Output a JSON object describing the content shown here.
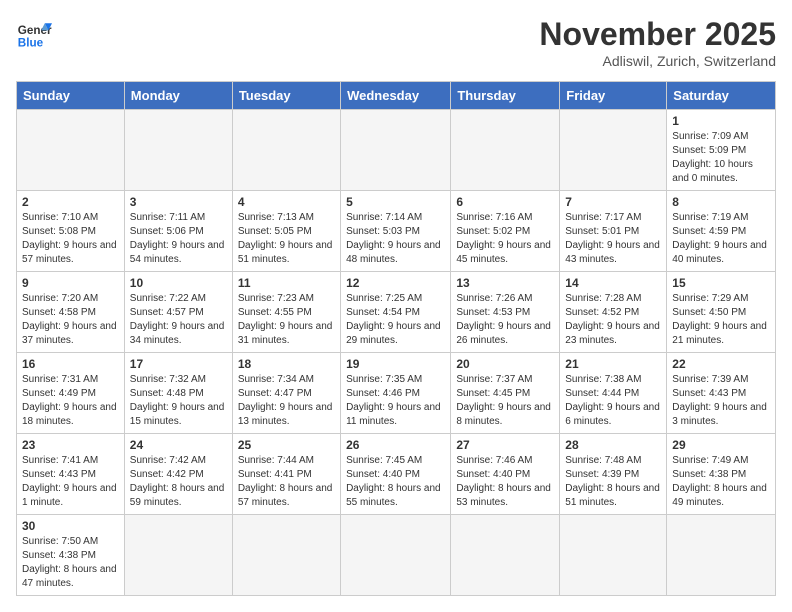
{
  "header": {
    "logo_general": "General",
    "logo_blue": "Blue",
    "month_title": "November 2025",
    "location": "Adliswil, Zurich, Switzerland"
  },
  "days_of_week": [
    "Sunday",
    "Monday",
    "Tuesday",
    "Wednesday",
    "Thursday",
    "Friday",
    "Saturday"
  ],
  "weeks": [
    [
      {
        "day": "",
        "info": ""
      },
      {
        "day": "",
        "info": ""
      },
      {
        "day": "",
        "info": ""
      },
      {
        "day": "",
        "info": ""
      },
      {
        "day": "",
        "info": ""
      },
      {
        "day": "",
        "info": ""
      },
      {
        "day": "1",
        "info": "Sunrise: 7:09 AM\nSunset: 5:09 PM\nDaylight: 10 hours and 0 minutes."
      }
    ],
    [
      {
        "day": "2",
        "info": "Sunrise: 7:10 AM\nSunset: 5:08 PM\nDaylight: 9 hours and 57 minutes."
      },
      {
        "day": "3",
        "info": "Sunrise: 7:11 AM\nSunset: 5:06 PM\nDaylight: 9 hours and 54 minutes."
      },
      {
        "day": "4",
        "info": "Sunrise: 7:13 AM\nSunset: 5:05 PM\nDaylight: 9 hours and 51 minutes."
      },
      {
        "day": "5",
        "info": "Sunrise: 7:14 AM\nSunset: 5:03 PM\nDaylight: 9 hours and 48 minutes."
      },
      {
        "day": "6",
        "info": "Sunrise: 7:16 AM\nSunset: 5:02 PM\nDaylight: 9 hours and 45 minutes."
      },
      {
        "day": "7",
        "info": "Sunrise: 7:17 AM\nSunset: 5:01 PM\nDaylight: 9 hours and 43 minutes."
      },
      {
        "day": "8",
        "info": "Sunrise: 7:19 AM\nSunset: 4:59 PM\nDaylight: 9 hours and 40 minutes."
      }
    ],
    [
      {
        "day": "9",
        "info": "Sunrise: 7:20 AM\nSunset: 4:58 PM\nDaylight: 9 hours and 37 minutes."
      },
      {
        "day": "10",
        "info": "Sunrise: 7:22 AM\nSunset: 4:57 PM\nDaylight: 9 hours and 34 minutes."
      },
      {
        "day": "11",
        "info": "Sunrise: 7:23 AM\nSunset: 4:55 PM\nDaylight: 9 hours and 31 minutes."
      },
      {
        "day": "12",
        "info": "Sunrise: 7:25 AM\nSunset: 4:54 PM\nDaylight: 9 hours and 29 minutes."
      },
      {
        "day": "13",
        "info": "Sunrise: 7:26 AM\nSunset: 4:53 PM\nDaylight: 9 hours and 26 minutes."
      },
      {
        "day": "14",
        "info": "Sunrise: 7:28 AM\nSunset: 4:52 PM\nDaylight: 9 hours and 23 minutes."
      },
      {
        "day": "15",
        "info": "Sunrise: 7:29 AM\nSunset: 4:50 PM\nDaylight: 9 hours and 21 minutes."
      }
    ],
    [
      {
        "day": "16",
        "info": "Sunrise: 7:31 AM\nSunset: 4:49 PM\nDaylight: 9 hours and 18 minutes."
      },
      {
        "day": "17",
        "info": "Sunrise: 7:32 AM\nSunset: 4:48 PM\nDaylight: 9 hours and 15 minutes."
      },
      {
        "day": "18",
        "info": "Sunrise: 7:34 AM\nSunset: 4:47 PM\nDaylight: 9 hours and 13 minutes."
      },
      {
        "day": "19",
        "info": "Sunrise: 7:35 AM\nSunset: 4:46 PM\nDaylight: 9 hours and 11 minutes."
      },
      {
        "day": "20",
        "info": "Sunrise: 7:37 AM\nSunset: 4:45 PM\nDaylight: 9 hours and 8 minutes."
      },
      {
        "day": "21",
        "info": "Sunrise: 7:38 AM\nSunset: 4:44 PM\nDaylight: 9 hours and 6 minutes."
      },
      {
        "day": "22",
        "info": "Sunrise: 7:39 AM\nSunset: 4:43 PM\nDaylight: 9 hours and 3 minutes."
      }
    ],
    [
      {
        "day": "23",
        "info": "Sunrise: 7:41 AM\nSunset: 4:43 PM\nDaylight: 9 hours and 1 minute."
      },
      {
        "day": "24",
        "info": "Sunrise: 7:42 AM\nSunset: 4:42 PM\nDaylight: 8 hours and 59 minutes."
      },
      {
        "day": "25",
        "info": "Sunrise: 7:44 AM\nSunset: 4:41 PM\nDaylight: 8 hours and 57 minutes."
      },
      {
        "day": "26",
        "info": "Sunrise: 7:45 AM\nSunset: 4:40 PM\nDaylight: 8 hours and 55 minutes."
      },
      {
        "day": "27",
        "info": "Sunrise: 7:46 AM\nSunset: 4:40 PM\nDaylight: 8 hours and 53 minutes."
      },
      {
        "day": "28",
        "info": "Sunrise: 7:48 AM\nSunset: 4:39 PM\nDaylight: 8 hours and 51 minutes."
      },
      {
        "day": "29",
        "info": "Sunrise: 7:49 AM\nSunset: 4:38 PM\nDaylight: 8 hours and 49 minutes."
      }
    ],
    [
      {
        "day": "30",
        "info": "Sunrise: 7:50 AM\nSunset: 4:38 PM\nDaylight: 8 hours and 47 minutes."
      },
      {
        "day": "",
        "info": ""
      },
      {
        "day": "",
        "info": ""
      },
      {
        "day": "",
        "info": ""
      },
      {
        "day": "",
        "info": ""
      },
      {
        "day": "",
        "info": ""
      },
      {
        "day": "",
        "info": ""
      }
    ]
  ]
}
